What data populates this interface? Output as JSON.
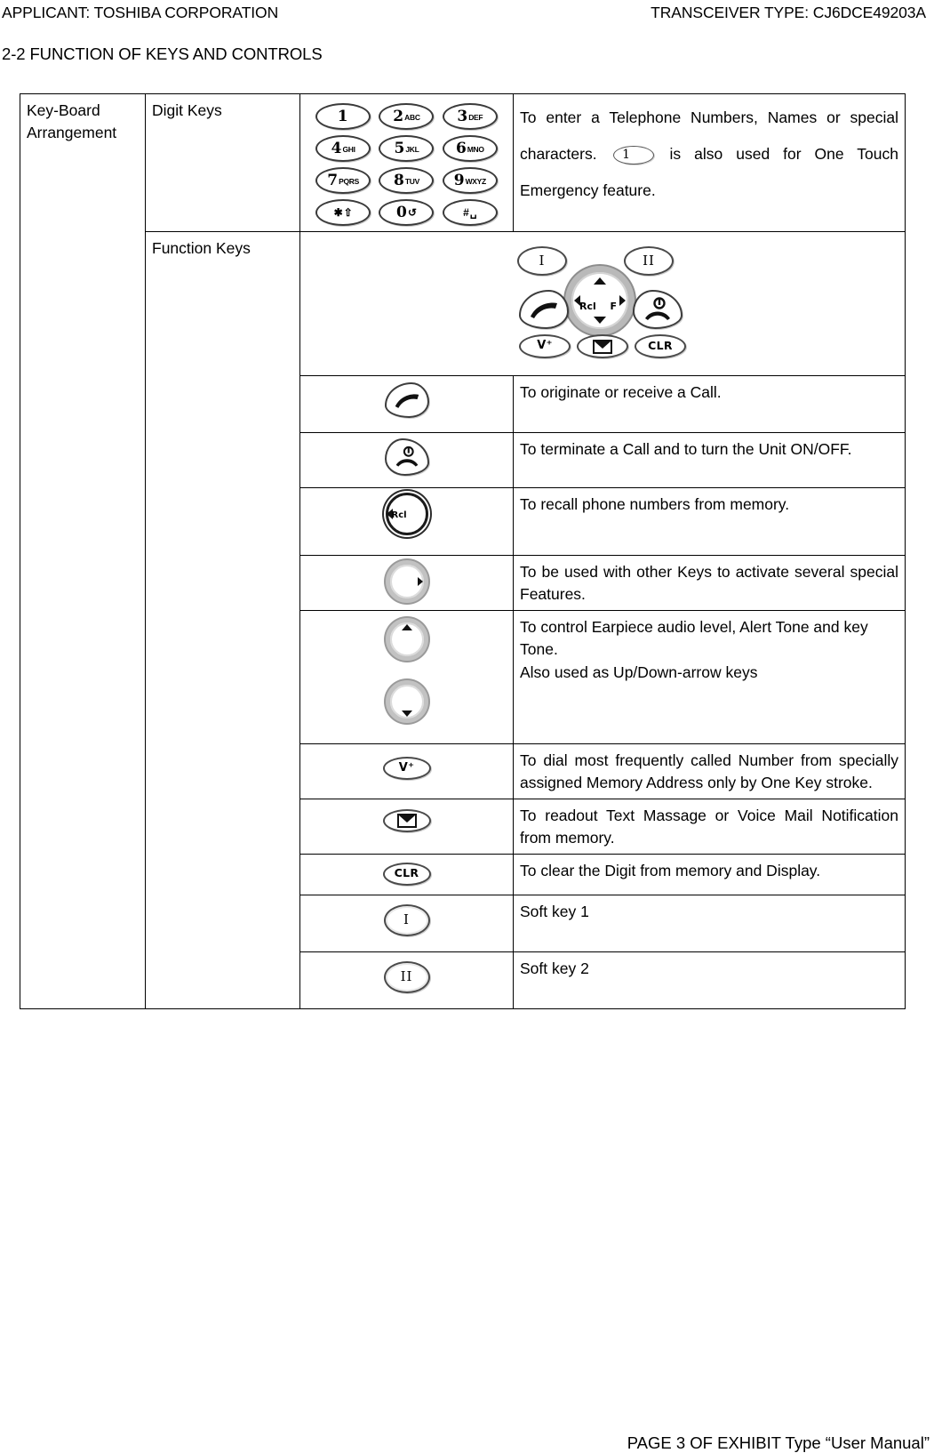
{
  "header": {
    "applicant": "APPLICANT: TOSHIBA CORPORATION",
    "transceiver": "TRANSCEIVER TYPE: CJ6DCE49203A"
  },
  "section": {
    "title": "2-2 FUNCTION OF KEYS AND CONTROLS"
  },
  "table": {
    "category": "Key-Board Arrangement",
    "groups": {
      "digit_keys": "Digit Keys",
      "function_keys": "Function Keys"
    },
    "digit_description": {
      "part1": "To enter a Telephone Numbers, Names or special characters.",
      "inline_icon": "key-1-icon",
      "inline_icon_label": "1",
      "part2": "is also used for One Touch Emergency feature."
    },
    "rows": [
      {
        "icon": "send-key-icon",
        "description": "To originate or receive a Call."
      },
      {
        "icon": "end-power-key-icon",
        "description": "To terminate a Call and to turn the Unit ON/OFF."
      },
      {
        "icon": "recall-key-icon",
        "description": "To recall phone numbers from memory."
      },
      {
        "icon": "function-key-icon",
        "description": "To be used with other Keys to activate several special Features."
      },
      {
        "icon": "up-down-arrow-keys-icon",
        "description": "To control Earpiece audio level, Alert Tone and key Tone.\nAlso used as Up/Down-arrow keys"
      },
      {
        "icon": "voice-dial-key-icon",
        "description": "To dial most frequently called Number from specially assigned Memory Address only by One Key stroke."
      },
      {
        "icon": "message-key-icon",
        "description": "To readout Text Massage or Voice Mail Notification from memory."
      },
      {
        "icon": "clear-key-icon",
        "description": "To clear the Digit from memory and Display."
      },
      {
        "icon": "soft-key-1-icon",
        "description": "Soft key 1"
      },
      {
        "icon": "soft-key-2-icon",
        "description": "Soft key 2"
      }
    ]
  },
  "keypad": {
    "keys": [
      {
        "num": "1",
        "letters": ""
      },
      {
        "num": "2",
        "letters": "ABC"
      },
      {
        "num": "3",
        "letters": "DEF"
      },
      {
        "num": "4",
        "letters": "GHI"
      },
      {
        "num": "5",
        "letters": "JKL"
      },
      {
        "num": "6",
        "letters": "MNO"
      },
      {
        "num": "7",
        "letters": "PQRS"
      },
      {
        "num": "8",
        "letters": "TUV"
      },
      {
        "num": "9",
        "letters": "WXYZ"
      },
      {
        "num": "✱",
        "letters": "⇧"
      },
      {
        "num": "0",
        "letters": "↺"
      },
      {
        "num": "#",
        "letters": "␣"
      }
    ]
  },
  "function_cluster": {
    "soft_key_1": "I",
    "soft_key_2": "II",
    "nav_recall": "Rcl",
    "nav_function": "F",
    "voice_key": "V⁺",
    "clear_key": "CLR"
  },
  "footer": {
    "text": "PAGE 3 OF EXHIBIT Type “User Manual”"
  }
}
